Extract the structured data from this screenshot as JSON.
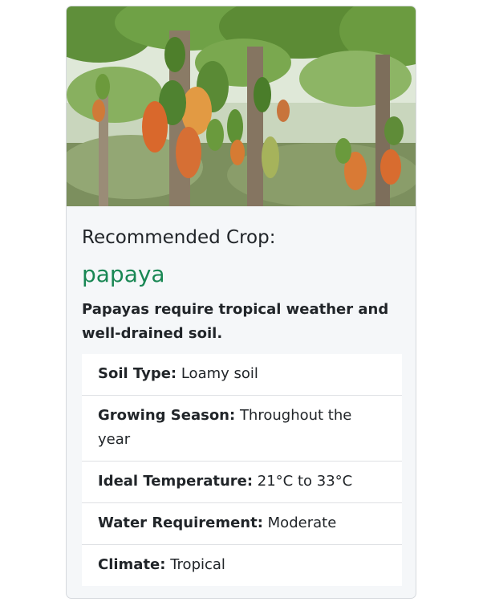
{
  "card": {
    "image_alt": "Papaya trees with fruit",
    "label": "Recommended Crop:",
    "crop": "papaya",
    "description": "Papayas require tropical weather and well-drained soil.",
    "details": [
      {
        "key": "Soil Type:",
        "value": "Loamy soil"
      },
      {
        "key": "Growing Season:",
        "value": "Throughout the year"
      },
      {
        "key": "Ideal Temperature:",
        "value": "21°C to 33°C"
      },
      {
        "key": "Water Requirement:",
        "value": "Moderate"
      },
      {
        "key": "Climate:",
        "value": "Tropical"
      }
    ]
  },
  "colors": {
    "crop_name": "#198754",
    "card_bg": "#f5f7f9"
  }
}
